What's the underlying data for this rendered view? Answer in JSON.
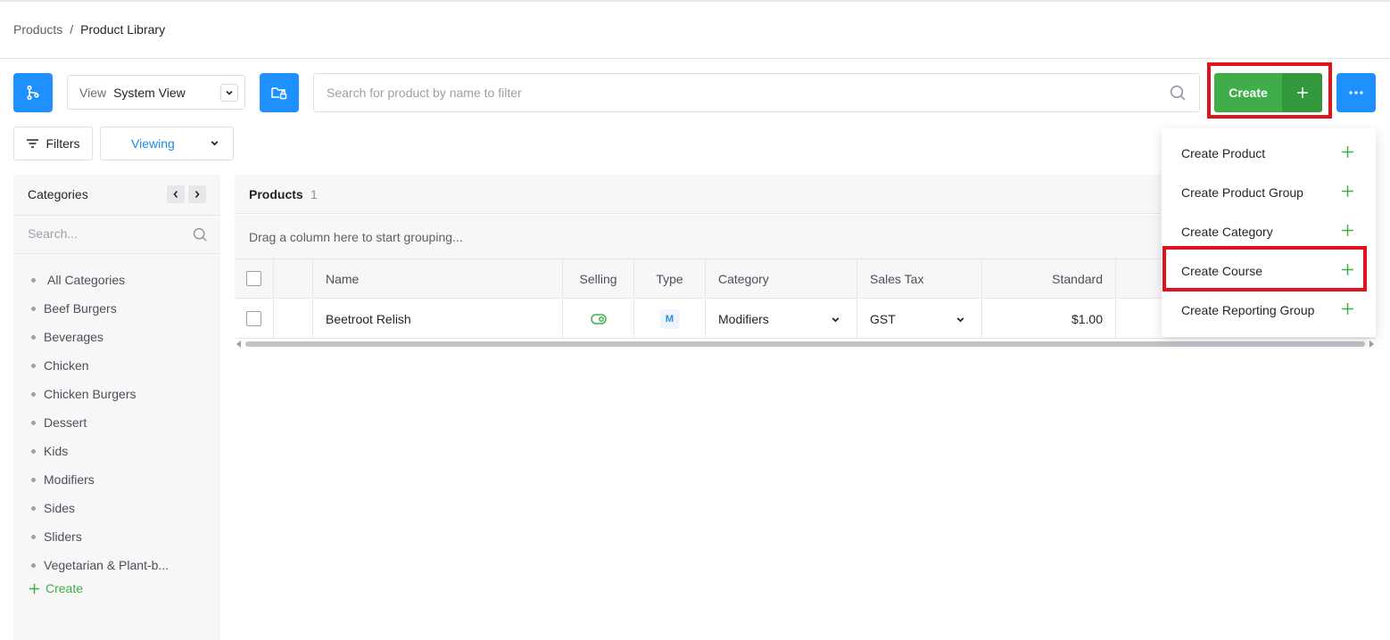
{
  "breadcrumb": {
    "parent": "Products",
    "separator": "/",
    "current": "Product Library"
  },
  "toolbar": {
    "view_label": "View",
    "view_value": "System View",
    "search_placeholder": "Search for product by name to filter",
    "create_label": "Create",
    "filters_label": "Filters",
    "viewing_label": "Viewing"
  },
  "icons": {
    "hierarchy": "git-branch-icon",
    "folder_lock": "folder-lock-icon",
    "search": "search-icon",
    "plus": "plus-icon",
    "more": "ellipsis-icon",
    "filter": "filter-lines-icon",
    "chevron": "chevron-down-icon",
    "toggle": "toggle-on-icon"
  },
  "colors": {
    "primary_blue": "#1e90ff",
    "create_green": "#3fae49",
    "highlight_red": "#e0121b"
  },
  "sidebar": {
    "title": "Categories",
    "search_placeholder": "Search...",
    "items": [
      "All Categories",
      "Beef Burgers",
      "Beverages",
      "Chicken",
      "Chicken Burgers",
      "Dessert",
      "Kids",
      "Modifiers",
      "Sides",
      "Sliders",
      "Vegetarian & Plant-b..."
    ],
    "create_label": "Create"
  },
  "grid": {
    "title": "Products",
    "count": "1",
    "group_hint": "Drag a column here to start grouping...",
    "columns": [
      "Name",
      "Selling",
      "Type",
      "Category",
      "Sales Tax",
      "Standard"
    ],
    "rows": [
      {
        "name": "Beetroot Relish",
        "selling": true,
        "type": "M",
        "category": "Modifiers",
        "sales_tax": "GST",
        "standard": "$1.00"
      }
    ]
  },
  "create_menu": {
    "items": [
      "Create Product",
      "Create Product Group",
      "Create Category",
      "Create Course",
      "Create Reporting Group"
    ],
    "highlighted_item": "Create Course"
  }
}
